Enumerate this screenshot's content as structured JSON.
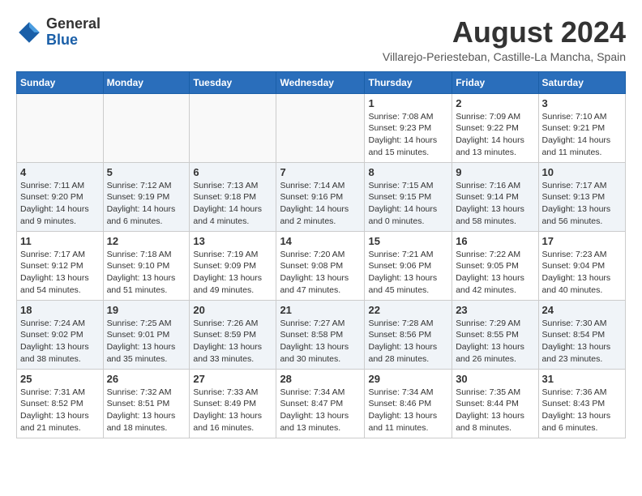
{
  "logo": {
    "general": "General",
    "blue": "Blue"
  },
  "title": {
    "month_year": "August 2024",
    "location": "Villarejo-Periesteban, Castille-La Mancha, Spain"
  },
  "weekdays": [
    "Sunday",
    "Monday",
    "Tuesday",
    "Wednesday",
    "Thursday",
    "Friday",
    "Saturday"
  ],
  "weeks": [
    [
      {
        "day": "",
        "info": ""
      },
      {
        "day": "",
        "info": ""
      },
      {
        "day": "",
        "info": ""
      },
      {
        "day": "",
        "info": ""
      },
      {
        "day": "1",
        "info": "Sunrise: 7:08 AM\nSunset: 9:23 PM\nDaylight: 14 hours\nand 15 minutes."
      },
      {
        "day": "2",
        "info": "Sunrise: 7:09 AM\nSunset: 9:22 PM\nDaylight: 14 hours\nand 13 minutes."
      },
      {
        "day": "3",
        "info": "Sunrise: 7:10 AM\nSunset: 9:21 PM\nDaylight: 14 hours\nand 11 minutes."
      }
    ],
    [
      {
        "day": "4",
        "info": "Sunrise: 7:11 AM\nSunset: 9:20 PM\nDaylight: 14 hours\nand 9 minutes."
      },
      {
        "day": "5",
        "info": "Sunrise: 7:12 AM\nSunset: 9:19 PM\nDaylight: 14 hours\nand 6 minutes."
      },
      {
        "day": "6",
        "info": "Sunrise: 7:13 AM\nSunset: 9:18 PM\nDaylight: 14 hours\nand 4 minutes."
      },
      {
        "day": "7",
        "info": "Sunrise: 7:14 AM\nSunset: 9:16 PM\nDaylight: 14 hours\nand 2 minutes."
      },
      {
        "day": "8",
        "info": "Sunrise: 7:15 AM\nSunset: 9:15 PM\nDaylight: 14 hours\nand 0 minutes."
      },
      {
        "day": "9",
        "info": "Sunrise: 7:16 AM\nSunset: 9:14 PM\nDaylight: 13 hours\nand 58 minutes."
      },
      {
        "day": "10",
        "info": "Sunrise: 7:17 AM\nSunset: 9:13 PM\nDaylight: 13 hours\nand 56 minutes."
      }
    ],
    [
      {
        "day": "11",
        "info": "Sunrise: 7:17 AM\nSunset: 9:12 PM\nDaylight: 13 hours\nand 54 minutes."
      },
      {
        "day": "12",
        "info": "Sunrise: 7:18 AM\nSunset: 9:10 PM\nDaylight: 13 hours\nand 51 minutes."
      },
      {
        "day": "13",
        "info": "Sunrise: 7:19 AM\nSunset: 9:09 PM\nDaylight: 13 hours\nand 49 minutes."
      },
      {
        "day": "14",
        "info": "Sunrise: 7:20 AM\nSunset: 9:08 PM\nDaylight: 13 hours\nand 47 minutes."
      },
      {
        "day": "15",
        "info": "Sunrise: 7:21 AM\nSunset: 9:06 PM\nDaylight: 13 hours\nand 45 minutes."
      },
      {
        "day": "16",
        "info": "Sunrise: 7:22 AM\nSunset: 9:05 PM\nDaylight: 13 hours\nand 42 minutes."
      },
      {
        "day": "17",
        "info": "Sunrise: 7:23 AM\nSunset: 9:04 PM\nDaylight: 13 hours\nand 40 minutes."
      }
    ],
    [
      {
        "day": "18",
        "info": "Sunrise: 7:24 AM\nSunset: 9:02 PM\nDaylight: 13 hours\nand 38 minutes."
      },
      {
        "day": "19",
        "info": "Sunrise: 7:25 AM\nSunset: 9:01 PM\nDaylight: 13 hours\nand 35 minutes."
      },
      {
        "day": "20",
        "info": "Sunrise: 7:26 AM\nSunset: 8:59 PM\nDaylight: 13 hours\nand 33 minutes."
      },
      {
        "day": "21",
        "info": "Sunrise: 7:27 AM\nSunset: 8:58 PM\nDaylight: 13 hours\nand 30 minutes."
      },
      {
        "day": "22",
        "info": "Sunrise: 7:28 AM\nSunset: 8:56 PM\nDaylight: 13 hours\nand 28 minutes."
      },
      {
        "day": "23",
        "info": "Sunrise: 7:29 AM\nSunset: 8:55 PM\nDaylight: 13 hours\nand 26 minutes."
      },
      {
        "day": "24",
        "info": "Sunrise: 7:30 AM\nSunset: 8:54 PM\nDaylight: 13 hours\nand 23 minutes."
      }
    ],
    [
      {
        "day": "25",
        "info": "Sunrise: 7:31 AM\nSunset: 8:52 PM\nDaylight: 13 hours\nand 21 minutes."
      },
      {
        "day": "26",
        "info": "Sunrise: 7:32 AM\nSunset: 8:51 PM\nDaylight: 13 hours\nand 18 minutes."
      },
      {
        "day": "27",
        "info": "Sunrise: 7:33 AM\nSunset: 8:49 PM\nDaylight: 13 hours\nand 16 minutes."
      },
      {
        "day": "28",
        "info": "Sunrise: 7:34 AM\nSunset: 8:47 PM\nDaylight: 13 hours\nand 13 minutes."
      },
      {
        "day": "29",
        "info": "Sunrise: 7:34 AM\nSunset: 8:46 PM\nDaylight: 13 hours\nand 11 minutes."
      },
      {
        "day": "30",
        "info": "Sunrise: 7:35 AM\nSunset: 8:44 PM\nDaylight: 13 hours\nand 8 minutes."
      },
      {
        "day": "31",
        "info": "Sunrise: 7:36 AM\nSunset: 8:43 PM\nDaylight: 13 hours\nand 6 minutes."
      }
    ]
  ]
}
